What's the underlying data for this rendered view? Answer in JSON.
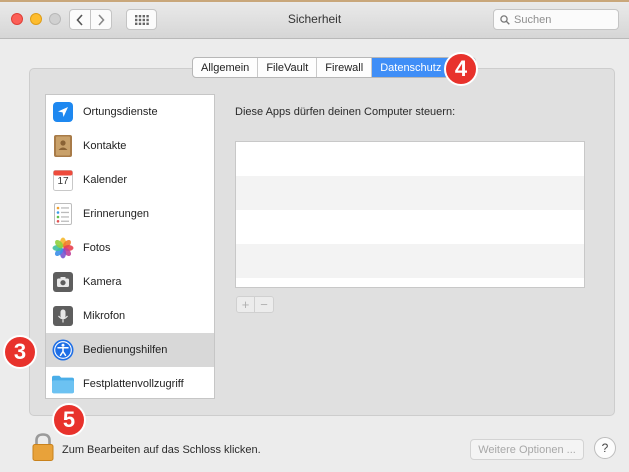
{
  "window": {
    "title": "Sicherheit",
    "search_placeholder": "Suchen"
  },
  "tabs": [
    {
      "label": "Allgemein",
      "selected": false
    },
    {
      "label": "FileVault",
      "selected": false
    },
    {
      "label": "Firewall",
      "selected": false
    },
    {
      "label": "Datenschutz",
      "selected": true
    }
  ],
  "sidebar": {
    "items": [
      {
        "label": "Ortungsdienste",
        "icon": "location-arrow-icon",
        "selected": false
      },
      {
        "label": "Kontakte",
        "icon": "contacts-book-icon",
        "selected": false
      },
      {
        "label": "Kalender",
        "icon": "calendar-icon",
        "calendar_day": "17",
        "selected": false
      },
      {
        "label": "Erinnerungen",
        "icon": "reminders-icon",
        "selected": false
      },
      {
        "label": "Fotos",
        "icon": "photos-flower-icon",
        "selected": false
      },
      {
        "label": "Kamera",
        "icon": "camera-icon",
        "selected": false
      },
      {
        "label": "Mikrofon",
        "icon": "microphone-icon",
        "selected": false
      },
      {
        "label": "Bedienungshilfen",
        "icon": "accessibility-icon",
        "selected": true
      },
      {
        "label": "Festplattenvollzugriff",
        "icon": "folder-icon",
        "selected": false
      }
    ]
  },
  "main": {
    "description": "Diese Apps dürfen deinen Computer steuern:",
    "add_button": "+",
    "remove_button": "−"
  },
  "footer": {
    "lock_label": "Zum Bearbeiten auf das Schloss klicken.",
    "more_options_label": "Weitere Optionen ...",
    "help_label": "?"
  },
  "annotations": {
    "badge_3": "3",
    "badge_4": "4",
    "badge_5": "5"
  },
  "colors": {
    "accent_blue": "#3f8ef7",
    "annotation_red": "#e8322c"
  }
}
